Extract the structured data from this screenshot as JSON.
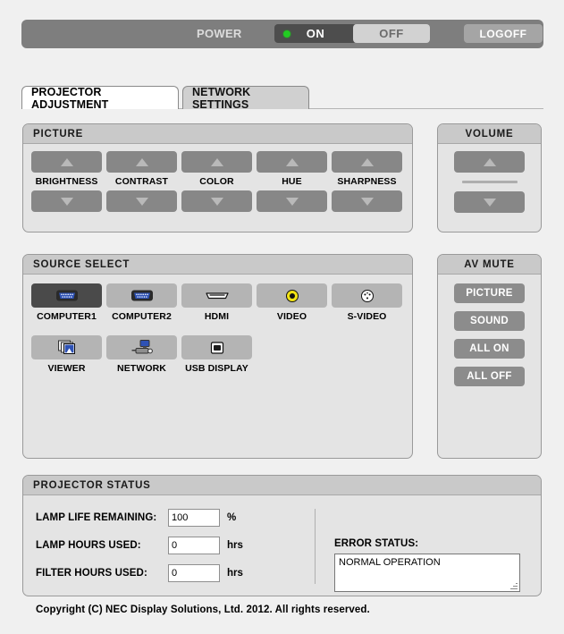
{
  "powerbar": {
    "power_label": "POWER",
    "on_label": "ON",
    "off_label": "OFF",
    "logoff_label": "LOGOFF",
    "led_color": "#22cc22",
    "on_state": "selected"
  },
  "tabs": [
    {
      "label": "PROJECTOR ADJUSTMENT",
      "active": true
    },
    {
      "label": "NETWORK SETTINGS",
      "active": false
    }
  ],
  "picture": {
    "title": "PICTURE",
    "items": [
      {
        "label": "BRIGHTNESS"
      },
      {
        "label": "CONTRAST"
      },
      {
        "label": "COLOR"
      },
      {
        "label": "HUE"
      },
      {
        "label": "SHARPNESS"
      }
    ]
  },
  "volume": {
    "title": "VOLUME"
  },
  "source": {
    "title": "SOURCE SELECT",
    "items": [
      {
        "label": "COMPUTER1",
        "icon": "vga-connector-icon",
        "selected": true
      },
      {
        "label": "COMPUTER2",
        "icon": "vga-connector-icon",
        "selected": false
      },
      {
        "label": "HDMI",
        "icon": "hdmi-connector-icon",
        "selected": false
      },
      {
        "label": "VIDEO",
        "icon": "rca-video-jack-icon",
        "selected": false
      },
      {
        "label": "S-VIDEO",
        "icon": "s-video-connector-icon",
        "selected": false
      },
      {
        "label": "VIEWER",
        "icon": "photo-stack-icon",
        "selected": false
      },
      {
        "label": "NETWORK",
        "icon": "network-projector-icon",
        "selected": false
      },
      {
        "label": "USB DISPLAY",
        "icon": "usb-connector-icon",
        "selected": false
      }
    ]
  },
  "avmute": {
    "title": "AV MUTE",
    "buttons": [
      {
        "label": "PICTURE"
      },
      {
        "label": "SOUND"
      },
      {
        "label": "ALL ON"
      },
      {
        "label": "ALL OFF"
      }
    ]
  },
  "status": {
    "title": "PROJECTOR STATUS",
    "rows": [
      {
        "label": "LAMP LIFE REMAINING:",
        "value": "100",
        "unit": "%"
      },
      {
        "label": "LAMP HOURS USED:",
        "value": "0",
        "unit": "hrs"
      },
      {
        "label": "FILTER HOURS USED:",
        "value": "0",
        "unit": "hrs"
      }
    ],
    "error_label": "ERROR STATUS:",
    "error_value": "NORMAL OPERATION"
  },
  "footer": {
    "copyright": "Copyright (C) NEC Display Solutions, Ltd. 2012. All rights reserved."
  }
}
